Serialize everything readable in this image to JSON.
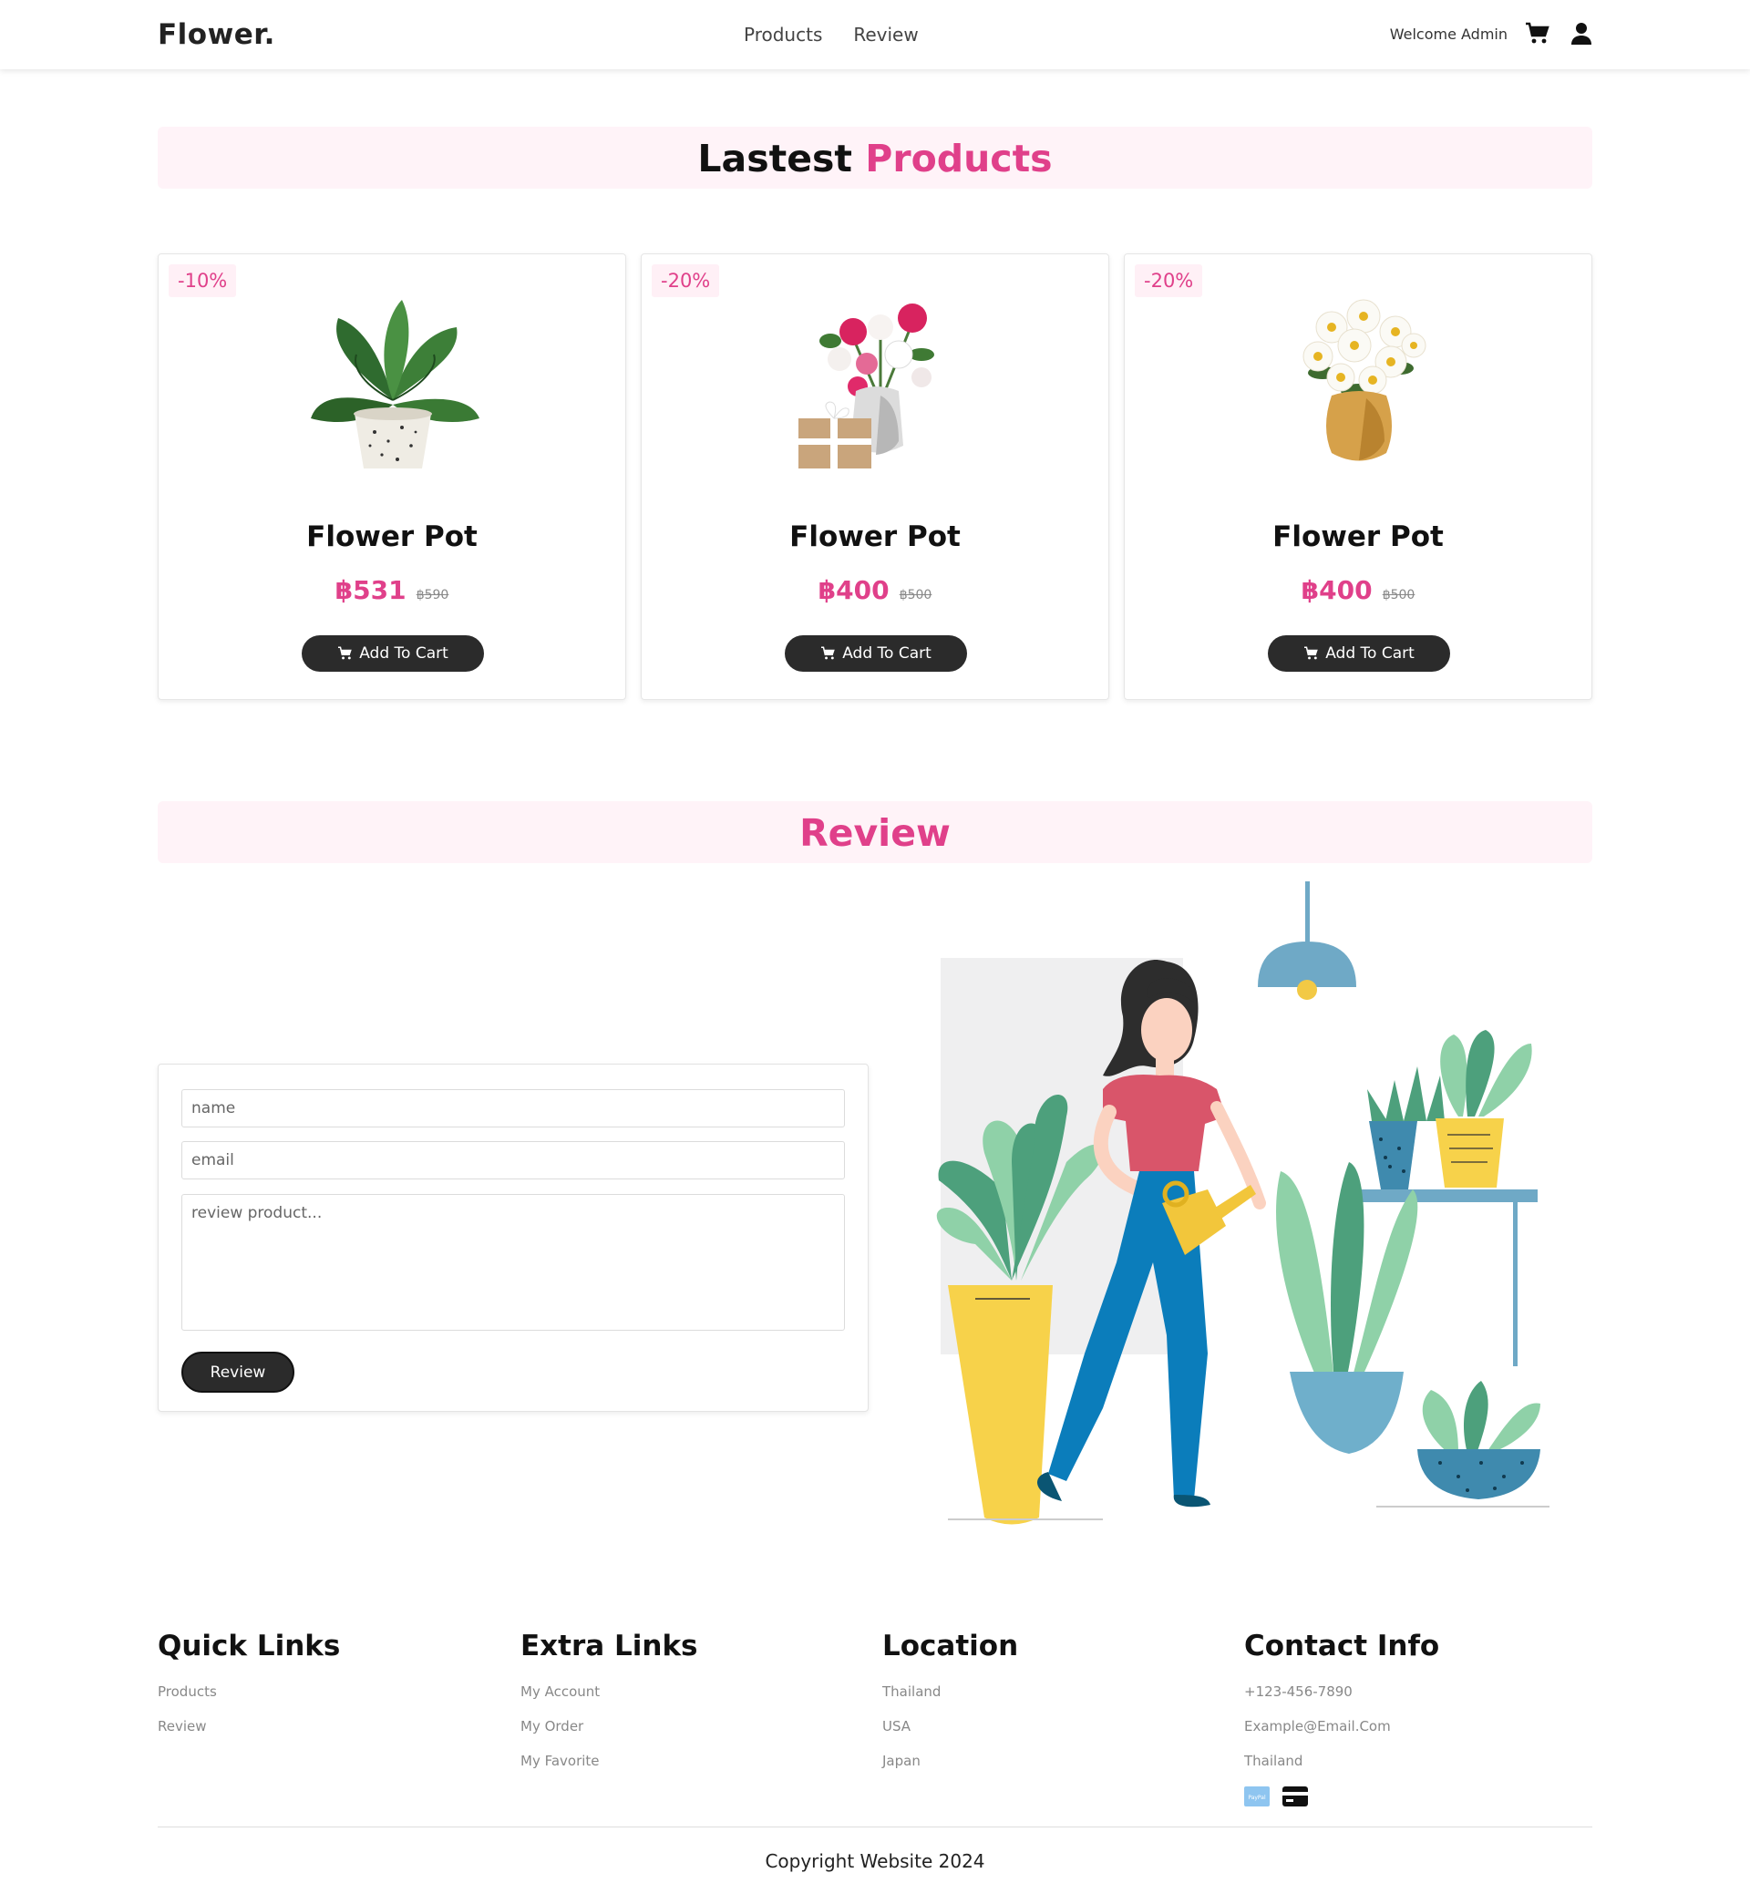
{
  "header": {
    "logo": "Flower.",
    "nav": [
      "Products",
      "Review"
    ],
    "welcome": "Welcome Admin",
    "cart_icon": "cart-icon",
    "user_icon": "user-icon"
  },
  "products_section": {
    "title_part1": "Lastest",
    "title_part2": "Products"
  },
  "products": [
    {
      "discount": "-10%",
      "name": "Flower Pot",
      "price": "฿531",
      "old_price": "฿590",
      "button": "Add To Cart",
      "image": "monstera-pot"
    },
    {
      "discount": "-20%",
      "name": "Flower Pot",
      "price": "฿400",
      "old_price": "฿500",
      "button": "Add To Cart",
      "image": "rose-bouquet-gift"
    },
    {
      "discount": "-20%",
      "name": "Flower Pot",
      "price": "฿400",
      "old_price": "฿500",
      "button": "Add To Cart",
      "image": "daisy-vase"
    }
  ],
  "review_section": {
    "title": "Review",
    "name_placeholder": "name",
    "email_placeholder": "email",
    "review_placeholder": "review product...",
    "button": "Review"
  },
  "footer": {
    "quick_links": {
      "title": "Quick Links",
      "items": [
        "Products",
        "Review"
      ]
    },
    "extra_links": {
      "title": "Extra Links",
      "items": [
        "My Account",
        "My Order",
        "My Favorite"
      ]
    },
    "location": {
      "title": "Location",
      "items": [
        "Thailand",
        "USA",
        "Japan"
      ]
    },
    "contact": {
      "title": "Contact Info",
      "items": [
        "+123-456-7890",
        "Example@Email.Com",
        "Thailand"
      ],
      "paypal_label": "PayPal"
    },
    "copyright": "Copyright Website 2024"
  },
  "colors": {
    "accent": "#e0408a",
    "button": "#2b2b2b",
    "heading_bg": "#fff3f8"
  }
}
